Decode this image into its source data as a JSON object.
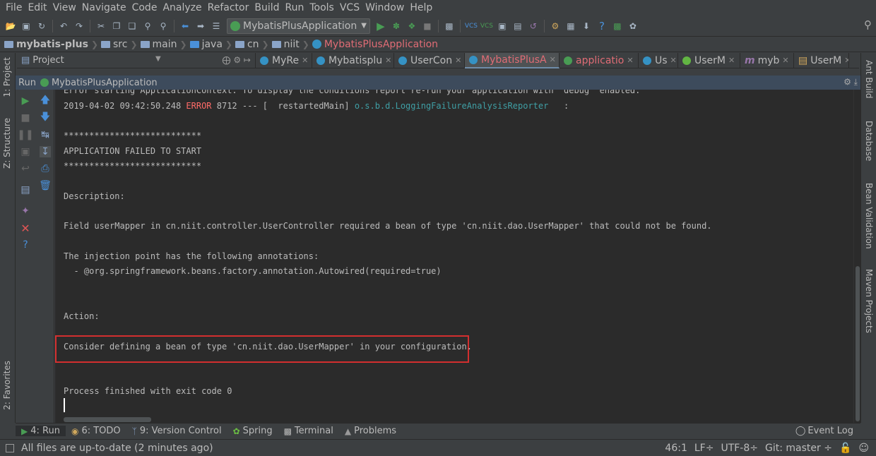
{
  "menu": [
    "File",
    "Edit",
    "View",
    "Navigate",
    "Code",
    "Analyze",
    "Refactor",
    "Build",
    "Run",
    "Tools",
    "VCS",
    "Window",
    "Help"
  ],
  "toolbar": {
    "run_config": "MybatisPlusApplication"
  },
  "breadcrumb": [
    "mybatis-plus",
    "src",
    "main",
    "java",
    "cn",
    "niit",
    "MybatisPlusApplication"
  ],
  "project_panel": {
    "title": "Project"
  },
  "editor_tabs": [
    "MyRe",
    "Mybatisplu",
    "UserCon",
    "MybatisPlusA",
    "applicatio",
    "Us",
    "UserM",
    "myb",
    "UserM"
  ],
  "left_tools": [
    "1: Project",
    "Z: Structure",
    "2: Favorites"
  ],
  "right_tools": [
    "Ant Build",
    "Database",
    "Bean Validation",
    "Maven Projects"
  ],
  "run_panel": {
    "label": "Run",
    "config": "MybatisPlusApplication"
  },
  "console": {
    "line0": "Error starting ApplicationContext. To display the conditions report re-run your application with 'debug' enabled.",
    "line1_ts": "2019-04-02 09:42:50.248 ",
    "line1_level": "ERROR",
    "line1_mid": " 8712 --- [  restartedMain] ",
    "line1_logger": "o.s.b.d.LoggingFailureAnalysisReporter",
    "line1_end": "   :",
    "stars1": "***************************",
    "failed": "APPLICATION FAILED TO START",
    "stars2": "***************************",
    "desc_head": "Description:",
    "desc": "Field userMapper in cn.niit.controller.UserController required a bean of type 'cn.niit.dao.UserMapper' that could not be found.",
    "inject": "The injection point has the following annotations:",
    "annot": "  - @org.springframework.beans.factory.annotation.Autowired(required=true)",
    "action_head": "Action:",
    "action": "Consider defining a bean of type 'cn.niit.dao.UserMapper' in your configuration.",
    "exit": "Process finished with exit code 0"
  },
  "bottom_tabs": [
    "4: Run",
    "6: TODO",
    "9: Version Control",
    "Spring",
    "Terminal",
    "Problems"
  ],
  "event_log": "Event Log",
  "status": {
    "message": "All files are up-to-date (2 minutes ago)",
    "position": "46:1",
    "line_sep": "LF÷",
    "encoding": "UTF-8÷",
    "git": "Git: master ÷"
  }
}
